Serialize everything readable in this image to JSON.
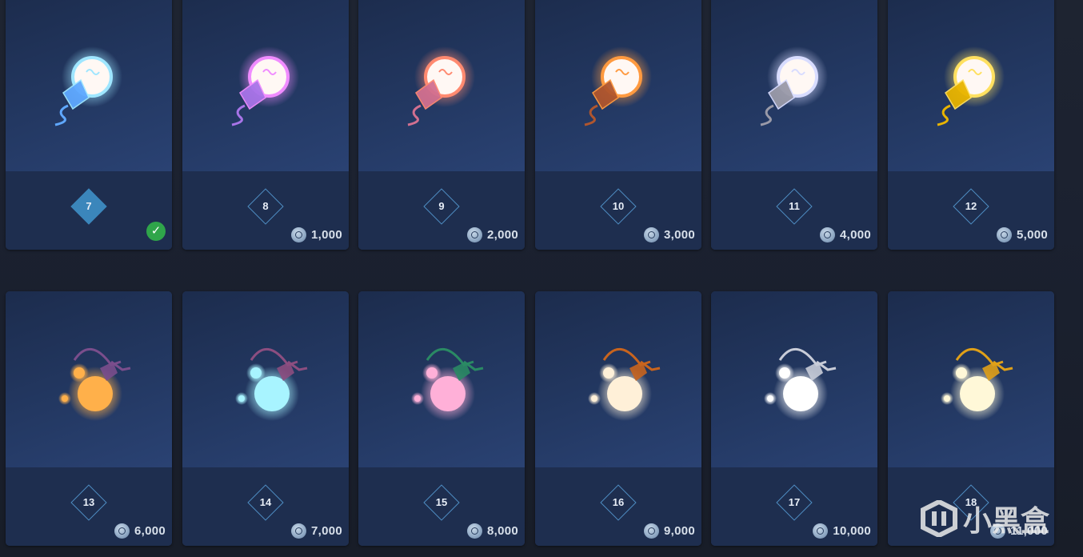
{
  "cards": [
    {
      "level": "7",
      "price": "",
      "owned": true,
      "color": "#5fa8ff",
      "glow": "#9fe6ff",
      "kind": "bulb"
    },
    {
      "level": "8",
      "price": "1,000",
      "owned": false,
      "color": "#a874e8",
      "glow": "#f08cff",
      "kind": "bulb"
    },
    {
      "level": "9",
      "price": "2,000",
      "owned": false,
      "color": "#d27090",
      "glow": "#ff8a70",
      "kind": "bulb"
    },
    {
      "level": "10",
      "price": "3,000",
      "owned": false,
      "color": "#b0562e",
      "glow": "#ff9a40",
      "kind": "bulb"
    },
    {
      "level": "11",
      "price": "4,000",
      "owned": false,
      "color": "#9a9aa8",
      "glow": "#d8dcff",
      "kind": "bulb"
    },
    {
      "level": "12",
      "price": "5,000",
      "owned": false,
      "color": "#e8b400",
      "glow": "#ffe060",
      "kind": "bulb"
    },
    {
      "level": "13",
      "price": "6,000",
      "owned": false,
      "color": "#7a4e8c",
      "glow": "#ffb04a",
      "kind": "cluster"
    },
    {
      "level": "14",
      "price": "7,000",
      "owned": false,
      "color": "#8c4e80",
      "glow": "#a8f4ff",
      "kind": "cluster"
    },
    {
      "level": "15",
      "price": "8,000",
      "owned": false,
      "color": "#2a8a64",
      "glow": "#ffb0d8",
      "kind": "cluster"
    },
    {
      "level": "16",
      "price": "9,000",
      "owned": false,
      "color": "#c8641e",
      "glow": "#fff0d8",
      "kind": "cluster"
    },
    {
      "level": "17",
      "price": "10,000",
      "owned": false,
      "color": "#c8ccd8",
      "glow": "#ffffff",
      "kind": "cluster"
    },
    {
      "level": "18",
      "price": "11,000",
      "owned": false,
      "color": "#e0a018",
      "glow": "#fff8d8",
      "kind": "cluster"
    }
  ],
  "icons": {
    "currency": "steam-points-icon",
    "owned": "checkmark-icon"
  },
  "watermark": {
    "text": "小黑盒"
  }
}
